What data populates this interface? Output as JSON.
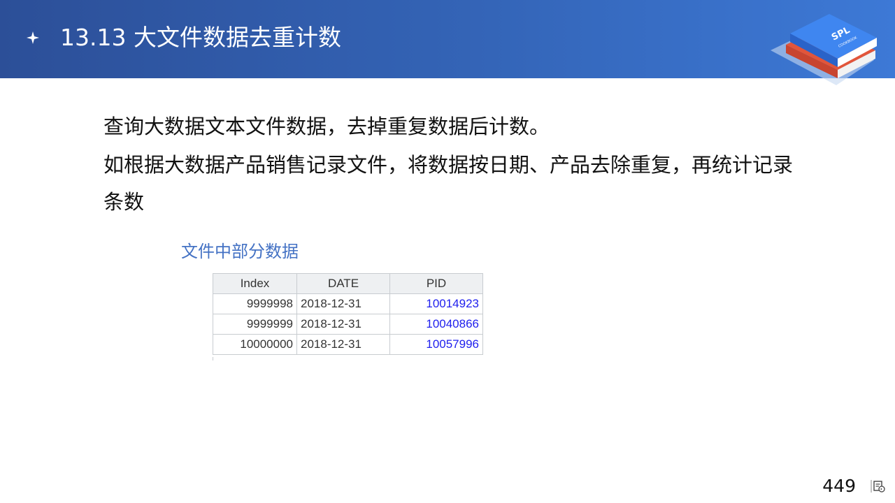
{
  "header": {
    "title": "13.13 大文件数据去重计数"
  },
  "body": {
    "paragraph1": "查询大数据文本文件数据，去掉重复数据后计数。",
    "paragraph2": "如根据大数据产品销售记录文件，将数据按日期、产品去除重复，再统计记录条数",
    "subtitle": "文件中部分数据"
  },
  "table": {
    "columns": [
      "Index",
      "DATE",
      "PID"
    ],
    "rows": [
      [
        "9999998",
        "2018-12-31",
        "10014923"
      ],
      [
        "9999999",
        "2018-12-31",
        "10040866"
      ],
      [
        "10000000",
        "2018-12-31",
        "10057996"
      ]
    ]
  },
  "logo": {
    "text_main": "SPL",
    "text_sub": "COOKBOOK"
  },
  "footer": {
    "page_number": "449"
  },
  "colors": {
    "header_bg": "#3465b8",
    "subtitle": "#4472c4",
    "pid_link": "#2020ee"
  }
}
